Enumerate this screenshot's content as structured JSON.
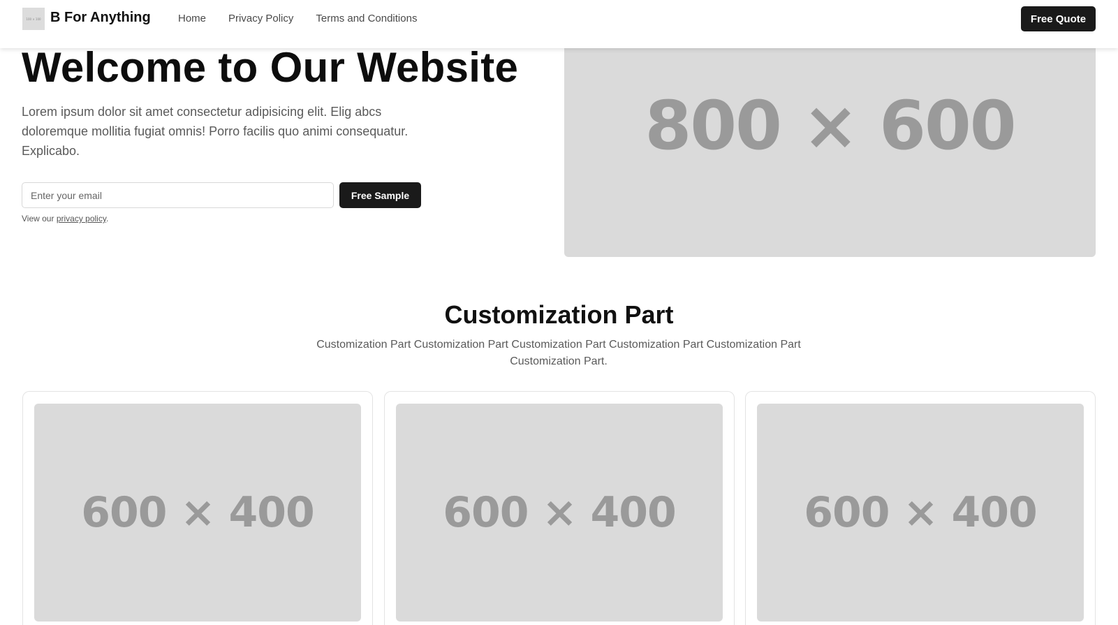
{
  "header": {
    "logo_text": "100 × 100",
    "brand": "B For Anything",
    "nav": [
      {
        "label": "Home"
      },
      {
        "label": "Privacy Policy"
      },
      {
        "label": "Terms and Conditions"
      }
    ],
    "cta_label": "Free Quote"
  },
  "hero": {
    "title": "Welcome to Our Website",
    "description": "Lorem ipsum dolor sit amet consectetur adipisicing elit. Elig abcs doloremque mollitia fugiat omnis! Porro facilis quo animi consequatur. Explicabo.",
    "email_placeholder": "Enter your email",
    "email_value": "",
    "submit_label": "Free Sample",
    "privacy_prefix": "View our ",
    "privacy_link": "privacy policy",
    "privacy_suffix": ".",
    "image_label": "800 × 600"
  },
  "section": {
    "title": "Customization Part",
    "description": "Customization Part Customization Part Customization Part Customization Part Customization Part Customization Part.",
    "cards": [
      {
        "image_label": "600 × 400"
      },
      {
        "image_label": "600 × 400"
      },
      {
        "image_label": "600 × 400"
      }
    ]
  },
  "colors": {
    "button_bg": "#1a1a1a",
    "placeholder_bg": "#dadada",
    "placeholder_text": "#9a9a9a",
    "muted_text": "#5a5a5a"
  }
}
